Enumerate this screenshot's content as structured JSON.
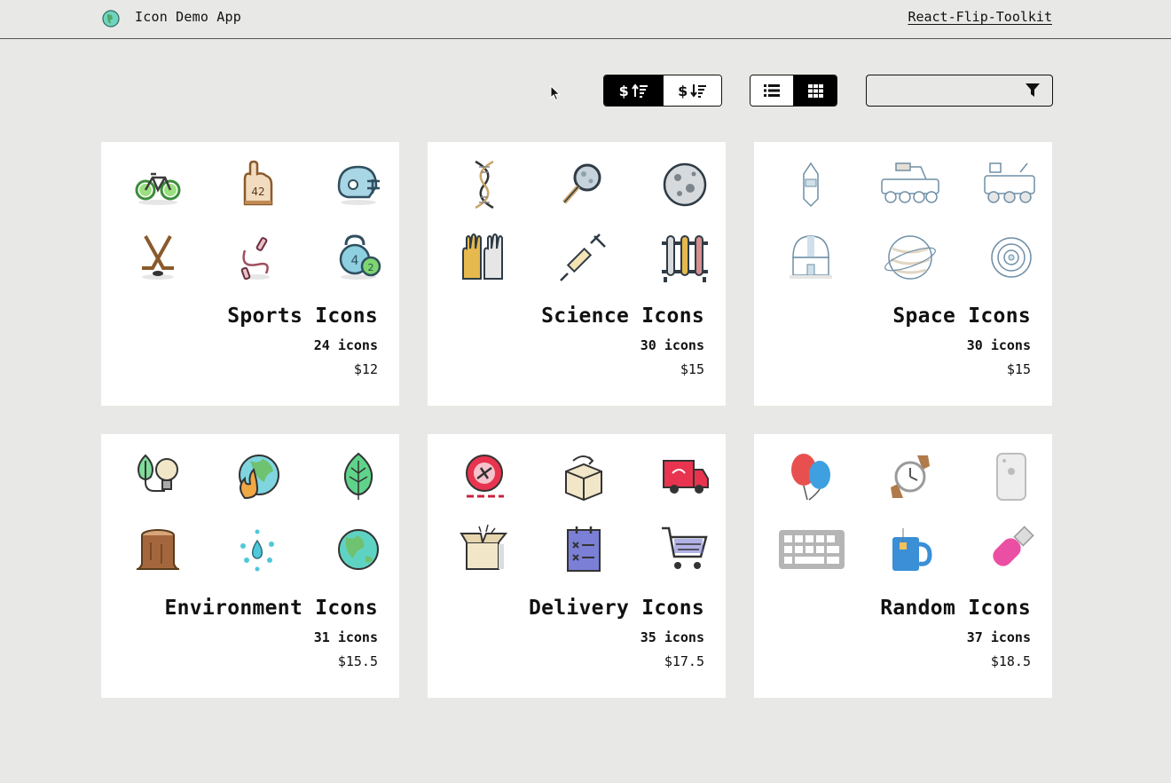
{
  "header": {
    "app_title": "Icon Demo App",
    "link_label": "React-Flip-Toolkit"
  },
  "toolbar": {
    "sort_asc": {
      "label": "$",
      "icon": "sort-amount-up-icon",
      "active": true
    },
    "sort_desc": {
      "label": "$",
      "icon": "sort-amount-down-icon",
      "active": false
    },
    "view_list": {
      "icon": "list-icon",
      "active": false
    },
    "view_grid": {
      "icon": "grid-icon",
      "active": true
    },
    "filter": {
      "value": "",
      "placeholder": "",
      "icon": "filter-icon"
    }
  },
  "cards": [
    {
      "title": "Sports Icons",
      "count": "24 icons",
      "price": "$12",
      "icons": [
        "bicycle-icon",
        "foam-finger-icon",
        "football-helmet-icon",
        "hockey-sticks-icon",
        "jump-rope-icon",
        "kettlebells-icon"
      ]
    },
    {
      "title": "Science Icons",
      "count": "30 icons",
      "price": "$15",
      "icons": [
        "dna-icon",
        "magnifying-glass-icon",
        "moon-icon",
        "lab-gloves-icon",
        "syringe-icon",
        "test-tubes-icon"
      ]
    },
    {
      "title": "Space Icons",
      "count": "30 icons",
      "price": "$15",
      "icons": [
        "space-capsule-icon",
        "moon-rover-icon",
        "mars-rover-icon",
        "observatory-icon",
        "planet-icon",
        "orbit-target-icon"
      ]
    },
    {
      "title": "Environment Icons",
      "count": "31 icons",
      "price": "$15.5",
      "icons": [
        "leaf-bulb-icon",
        "burning-earth-icon",
        "leaf-icon",
        "tree-stump-icon",
        "water-drops-icon",
        "earth-icon"
      ]
    },
    {
      "title": "Delivery Icons",
      "count": "35 icons",
      "price": "$17.5",
      "icons": [
        "air-delivery-badge-icon",
        "package-return-icon",
        "delivery-truck-icon",
        "open-box-icon",
        "checklist-icon",
        "shopping-cart-icon"
      ]
    },
    {
      "title": "Random Icons",
      "count": "37 icons",
      "price": "$18.5",
      "icons": [
        "balloons-icon",
        "wristwatch-icon",
        "phone-icon",
        "keyboard-icon",
        "tea-mug-icon",
        "usb-drive-icon"
      ]
    }
  ],
  "colors": {
    "background": "#e8e8e6",
    "card": "#ffffff",
    "active_button": "#000000",
    "text": "#111111"
  }
}
